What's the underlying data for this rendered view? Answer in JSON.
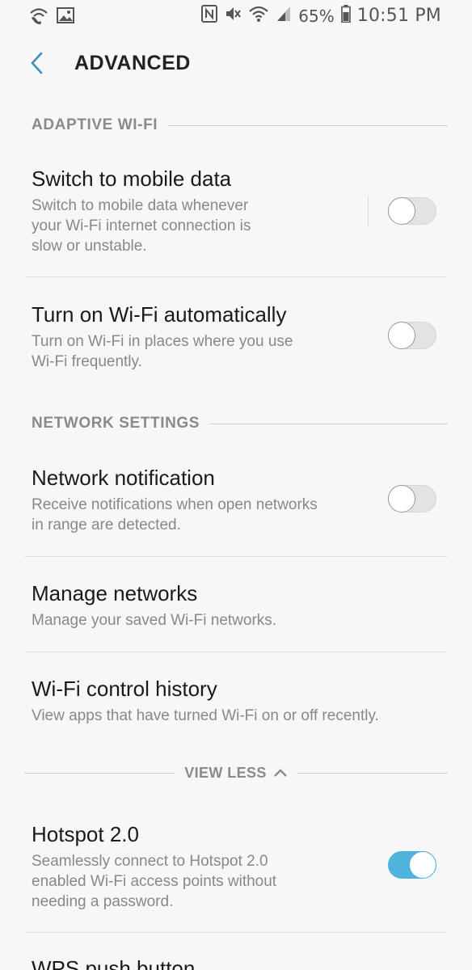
{
  "status_bar": {
    "left_icons": [
      "wifi-call-icon",
      "image-icon"
    ],
    "right_icons": [
      "nfc-icon",
      "mute-icon",
      "wifi-icon",
      "signal-icon",
      "battery-icon"
    ],
    "battery": "65%",
    "time": "10:51 PM"
  },
  "header": {
    "title": "ADVANCED",
    "back_icon": "chevron-left-icon"
  },
  "sections": {
    "adaptive": "ADAPTIVE WI-FI",
    "network": "NETWORK SETTINGS"
  },
  "items": {
    "switch_mobile": {
      "title": "Switch to mobile data",
      "subtitle": "Switch to mobile data whenever\nyour Wi-Fi internet connection is\nslow or unstable.",
      "toggle": "off"
    },
    "wifi_auto": {
      "title": "Turn on Wi-Fi automatically",
      "subtitle": "Turn on Wi-Fi in places where you use\nWi-Fi frequently.",
      "toggle": "off"
    },
    "network_notification": {
      "title": "Network notification",
      "subtitle": "Receive notifications when open networks\nin range are detected.",
      "toggle": "off"
    },
    "manage_networks": {
      "title": "Manage networks",
      "subtitle": "Manage your saved Wi-Fi networks."
    },
    "control_history": {
      "title": "Wi-Fi control history",
      "subtitle": "View apps that have turned Wi-Fi on or off recently."
    },
    "hotspot": {
      "title": "Hotspot 2.0",
      "subtitle": "Seamlessly connect to Hotspot 2.0\nenabled Wi-Fi access points without\nneeding a password.",
      "toggle": "on"
    },
    "wps": {
      "title": "WPS push button"
    }
  },
  "view_less": {
    "label": "VIEW LESS",
    "icon": "chevron-up-icon"
  },
  "colors": {
    "accent": "#4fb3dc",
    "background": "#f7f7f7",
    "section_title": "#8a8a8a"
  }
}
